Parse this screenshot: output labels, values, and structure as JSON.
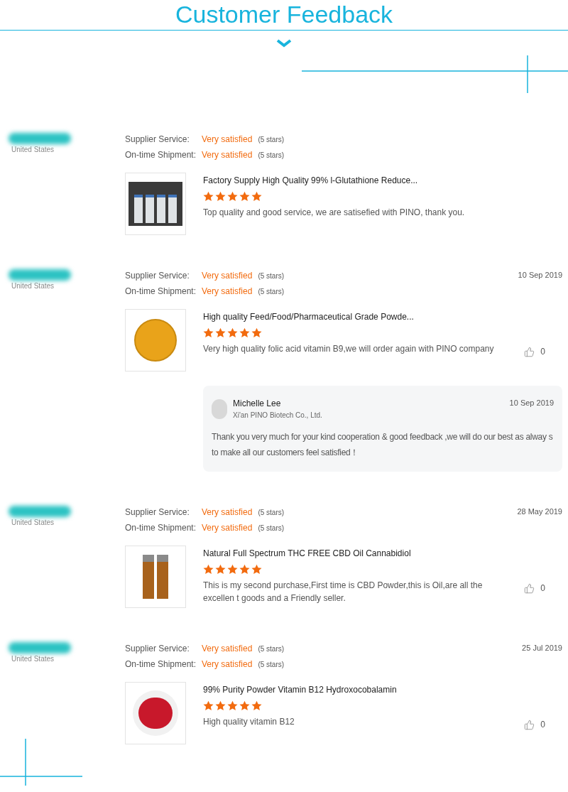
{
  "header": {
    "title": "Customer Feedback"
  },
  "reviews": [
    {
      "country": "United States",
      "ratings": [
        {
          "label": "Supplier Service:",
          "value": "Very satisfied",
          "note": "(5 stars)"
        },
        {
          "label": "On-time Shipment:",
          "value": "Very satisfied",
          "note": "(5 stars)"
        }
      ],
      "product": {
        "kind": "vials",
        "title": "Factory Supply High Quality 99% l-Glutathione Reduce...",
        "stars": 5,
        "comment": "Top quality and good service, we are satisefied with PINO, thank you."
      }
    },
    {
      "country": "United States",
      "date": "10 Sep 2019",
      "ratings": [
        {
          "label": "Supplier Service:",
          "value": "Very satisfied",
          "note": "(5 stars)"
        },
        {
          "label": "On-time Shipment:",
          "value": "Very satisfied",
          "note": "(5 stars)"
        }
      ],
      "product": {
        "kind": "orange-powder",
        "title": "High quality Feed/Food/Pharmaceutical Grade Powde...",
        "stars": 5,
        "comment": "Very high quality folic acid vitamin B9,we will order again with PINO company"
      },
      "likes": "0",
      "reply": {
        "name": "Michelle Lee",
        "company": "Xi'an PINO Biotech Co., Ltd.",
        "date": "10 Sep 2019",
        "text": "Thank you very much for your kind cooperation & good feedback ,we will do our best as alway s to make all our customers feel satisfied！"
      }
    },
    {
      "country": "United States",
      "date": "28 May 2019",
      "ratings": [
        {
          "label": "Supplier Service:",
          "value": "Very satisfied",
          "note": "(5 stars)"
        },
        {
          "label": "On-time Shipment:",
          "value": "Very satisfied",
          "note": "(5 stars)"
        }
      ],
      "product": {
        "kind": "oil-bottles",
        "title": "Natural Full Spectrum THC FREE CBD Oil Cannabidiol",
        "stars": 5,
        "comment": "This is my second purchase,First time is CBD Powder,this is Oil,are all the excellen t goods and a Friendly  seller."
      },
      "likes": "0"
    },
    {
      "country": "United States",
      "date": "25 Jul 2019",
      "ratings": [
        {
          "label": "Supplier Service:",
          "value": "Very satisfied",
          "note": "(5 stars)"
        },
        {
          "label": "On-time Shipment:",
          "value": "Very satisfied",
          "note": "(5 stars)"
        }
      ],
      "product": {
        "kind": "red-powder",
        "title": "99% Purity Powder Vitamin B12 Hydroxocobalamin",
        "stars": 5,
        "comment": "High quality vitamin B12"
      },
      "likes": "0"
    }
  ]
}
